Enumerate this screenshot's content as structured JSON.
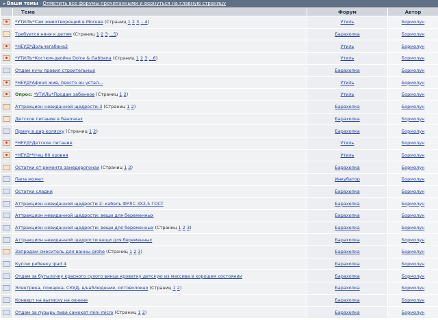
{
  "top": {
    "prefix": "Ваши темы",
    "separator": "·",
    "link": "Отметить все форумы прочитанными и вернуться на главную страницу"
  },
  "columns": {
    "topic": "Тема",
    "forum": "Форум",
    "author": "Автор"
  },
  "icons": {
    "new": "envelope-new-icon",
    "read": "envelope-read-icon",
    "hot": "envelope-hot-icon"
  },
  "rows": [
    {
      "icon": "hot",
      "prefix": "",
      "title": "*УТИЛЬ*Сэм животворящий в Москве",
      "pages_label": "(Страниц",
      "pages": [
        "1",
        "2",
        "3",
        "...4"
      ],
      "pages_close": ")",
      "forum": "Утиль",
      "author": "Бормолун"
    },
    {
      "icon": "new",
      "prefix": "",
      "title": "Требуется няня к детям",
      "pages_label": "(Страниц",
      "pages": [
        "1",
        "2",
        "3",
        "...5"
      ],
      "pages_close": ")",
      "forum": "Барахолка",
      "author": "Бормолун"
    },
    {
      "icon": "hot",
      "prefix": "",
      "title": "*НЕУД*Дольчегабана2",
      "pages_label": "",
      "pages": [],
      "pages_close": "",
      "forum": "Утиль",
      "author": "Бормолун"
    },
    {
      "icon": "hot",
      "prefix": "",
      "title": "*УТИЛЬ*Костюм-двойка Dolce & Gabbana",
      "pages_label": "(Страниц",
      "pages": [
        "1",
        "2",
        "3",
        "...6"
      ],
      "pages_close": ")",
      "forum": "Утиль",
      "author": "Бормолун"
    },
    {
      "icon": "read",
      "prefix": "",
      "title": "Отдам кучу правил строительных",
      "pages_label": "",
      "pages": [],
      "pages_close": "",
      "forum": "Барахолка",
      "author": "Бормолун"
    },
    {
      "icon": "hot",
      "prefix": "",
      "title": "*НЕУД*Афоня жив, просто он устал...",
      "pages_label": "",
      "pages": [],
      "pages_close": "",
      "forum": "Утиль",
      "author": "Бормолун"
    },
    {
      "icon": "hot",
      "prefix": "Опрос:",
      "title": "*УТИЛЬ*Продам забанеое",
      "pages_label": "(Страниц",
      "pages": [
        "1",
        "2"
      ],
      "pages_close": ")",
      "forum": "Утиль",
      "author": "Бормолун"
    },
    {
      "icon": "new",
      "prefix": "",
      "title": "Аттракцион невиданной щедрости-3",
      "pages_label": "(Страниц",
      "pages": [
        "1",
        "2"
      ],
      "pages_close": ")",
      "forum": "Барахолка",
      "author": "Бормолун"
    },
    {
      "icon": "new",
      "prefix": "",
      "title": "Детское питание в баночках",
      "pages_label": "",
      "pages": [],
      "pages_close": "",
      "forum": "Барахолка",
      "author": "Бормолун"
    },
    {
      "icon": "read",
      "prefix": "",
      "title": "Приму в дар коляску",
      "pages_label": "(Страниц",
      "pages": [
        "1",
        "2"
      ],
      "pages_close": ")",
      "forum": "Барахолка",
      "author": "Бормолун"
    },
    {
      "icon": "hot",
      "prefix": "",
      "title": "*НЕУД*Детское питание",
      "pages_label": "",
      "pages": [],
      "pages_close": "",
      "forum": "Утиль",
      "author": "Бормолун"
    },
    {
      "icon": "hot",
      "prefix": "",
      "title": "*НЕУД*Чтец 80 уровня",
      "pages_label": "",
      "pages": [],
      "pages_close": "",
      "forum": "Утиль",
      "author": "Бормолун"
    },
    {
      "icon": "new",
      "prefix": "",
      "title": "Остатки от ремонта занедорогонах",
      "pages_label": "(Страниц",
      "pages": [
        "1",
        "2"
      ],
      "pages_close": ")",
      "forum": "Барахолка",
      "author": "Бормолун"
    },
    {
      "icon": "read",
      "prefix": "",
      "title": "Папа может",
      "pages_label": "",
      "pages": [],
      "pages_close": "",
      "forum": "Инкубатор",
      "author": "Бормолун"
    },
    {
      "icon": "read",
      "prefix": "",
      "title": "Остатки сладки",
      "pages_label": "",
      "pages": [],
      "pages_close": "",
      "forum": "Барахолка",
      "author": "Бормолун"
    },
    {
      "icon": "read",
      "prefix": "",
      "title": "Аттракцион невиданной щедрости 2: кабель ФРЛС 3Х2,5 ГОСТ",
      "pages_label": "",
      "pages": [],
      "pages_close": "",
      "forum": "Барахолка",
      "author": "Бормолун"
    },
    {
      "icon": "read",
      "prefix": "",
      "title": "Аттракцион невиданной щедрости: вещи для беременных",
      "pages_label": "",
      "pages": [],
      "pages_close": "",
      "forum": "Барахолка",
      "author": "Бормолун"
    },
    {
      "icon": "read",
      "prefix": "",
      "title": "Аттракцион невиданной щедрости: вещи для беременных",
      "pages_label": "(Страниц",
      "pages": [
        "1",
        "2",
        "3"
      ],
      "pages_close": ")",
      "forum": "Барахолка",
      "author": "Бормолун"
    },
    {
      "icon": "read",
      "prefix": "",
      "title": "Аттракцион невиданной щедрости вещи для беременных",
      "pages_label": "",
      "pages": [],
      "pages_close": "",
      "forum": "Барахолка",
      "author": "Бормолун"
    },
    {
      "icon": "new",
      "prefix": "",
      "title": "Запродам смеситель для ванны grohe",
      "pages_label": "(Страниц",
      "pages": [
        "1",
        "2",
        "3"
      ],
      "pages_close": ")",
      "forum": "Барахолка",
      "author": "Бормолун"
    },
    {
      "icon": "read",
      "prefix": "",
      "title": "Куплю ребенку Ipad 4",
      "pages_label": "",
      "pages": [],
      "pages_close": "",
      "forum": "Барахолка",
      "author": "Бормолун"
    },
    {
      "icon": "read",
      "prefix": "",
      "title": "Отдам за бутылочку красного сухого винца кроватку детскую из массива в хорошем состоянии",
      "pages_label": "",
      "pages": [],
      "pages_close": "",
      "forum": "Барахолка",
      "author": "Бормолун"
    },
    {
      "icon": "read",
      "prefix": "",
      "title": "Электрика, пожарка, СКУД, в/наблюдение, оптоволокно",
      "pages_label": "(Страниц",
      "pages": [
        "1",
        "2"
      ],
      "pages_close": ")",
      "forum": "Барахолка",
      "author": "Бормолун"
    },
    {
      "icon": "read",
      "prefix": "",
      "title": "Конверт на выписку на овчине",
      "pages_label": "",
      "pages": [],
      "pages_close": "",
      "forum": "Барахолка",
      "author": "Бормолун"
    },
    {
      "icon": "read",
      "prefix": "",
      "title": "Отдам за пузырь пива самокат mini micro",
      "pages_label": "(Страниц",
      "pages": [
        "1",
        "2"
      ],
      "pages_close": ")",
      "forum": "Барахолка",
      "author": "Бормолун"
    }
  ]
}
